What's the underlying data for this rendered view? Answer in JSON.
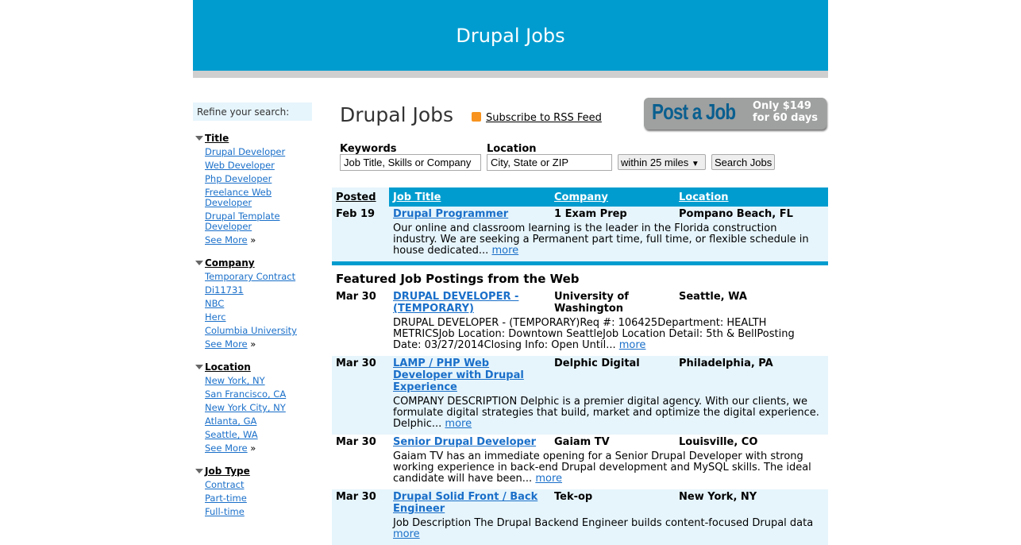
{
  "header": {
    "title": "Drupal Jobs"
  },
  "sidebar": {
    "refine": "Refine your search:",
    "see_more": "See More",
    "groups": [
      {
        "title": "Title",
        "items": [
          "Drupal Developer",
          "Web Developer",
          "Php Developer",
          "Freelance Web Developer",
          "Drupal Template Developer"
        ]
      },
      {
        "title": "Company",
        "items": [
          "Temporary Contract",
          "Di11731",
          "NBC",
          "Herc",
          "Columbia University"
        ]
      },
      {
        "title": "Location",
        "items": [
          "New York, NY",
          "San Francisco, CA",
          "New York City, NY",
          "Atlanta, GA",
          "Seattle, WA"
        ]
      },
      {
        "title": "Job Type",
        "items": [
          "Contract",
          "Part-time",
          "Full-time"
        ]
      }
    ]
  },
  "main": {
    "title": "Drupal Jobs",
    "rss": "Subscribe to RSS Feed",
    "post_job": "Post a Job",
    "post_price": "Only $149",
    "post_days": "for 60 days",
    "search": {
      "keywords_label": "Keywords",
      "keywords_placeholder": "Job Title, Skills or Company",
      "location_label": "Location",
      "location_placeholder": "City, State or ZIP",
      "radius": "within 25 miles",
      "button": "Search Jobs"
    },
    "columns": [
      "Posted",
      "Job Title",
      "Company",
      "Location"
    ],
    "more": "more",
    "jobs": [
      {
        "date": "Feb 19",
        "title": "Drupal Programmer",
        "company": "1 Exam Prep",
        "location": "Pompano Beach, FL",
        "desc": "Our online and classroom learning is the leader in the Florida construction industry. We are seeking a Permanent part time, full time, or flexible schedule in house dedicated..."
      }
    ],
    "featured_heading": "Featured Job Postings from the Web",
    "featured": [
      {
        "date": "Mar 30",
        "title": "DRUPAL DEVELOPER - (TEMPORARY)",
        "company": "University of Washington",
        "location": "Seattle, WA",
        "desc": "DRUPAL DEVELOPER - (TEMPORARY)Req #: 106425Department: HEALTH METRICSJob Location: Downtown SeattleJob Location Detail: 5th & BellPosting Date: 03/27/2014Closing Info: Open Until..."
      },
      {
        "date": "Mar 30",
        "title": "LAMP / PHP Web Developer with Drupal Experience",
        "company": "Delphic Digital",
        "location": "Philadelphia, PA",
        "desc": "COMPANY DESCRIPTION Delphic is a premier digital agency. With our clients, we formulate digital strategies that build, market and optimize the digital experience. Delphic..."
      },
      {
        "date": "Mar 30",
        "title": "Senior Drupal Developer",
        "company": "Gaiam TV",
        "location": "Louisville, CO",
        "desc": "Gaiam TV has an immediate opening for a Senior Drupal Developer with strong working experience in back-end Drupal development and MySQL skills. The ideal candidate will have been..."
      },
      {
        "date": "Mar 30",
        "title": "Drupal Solid Front / Back Engineer",
        "company": "Tek-op",
        "location": "New York, NY",
        "desc": "Job Description The Drupal Backend Engineer builds content-focused Drupal data"
      }
    ]
  }
}
